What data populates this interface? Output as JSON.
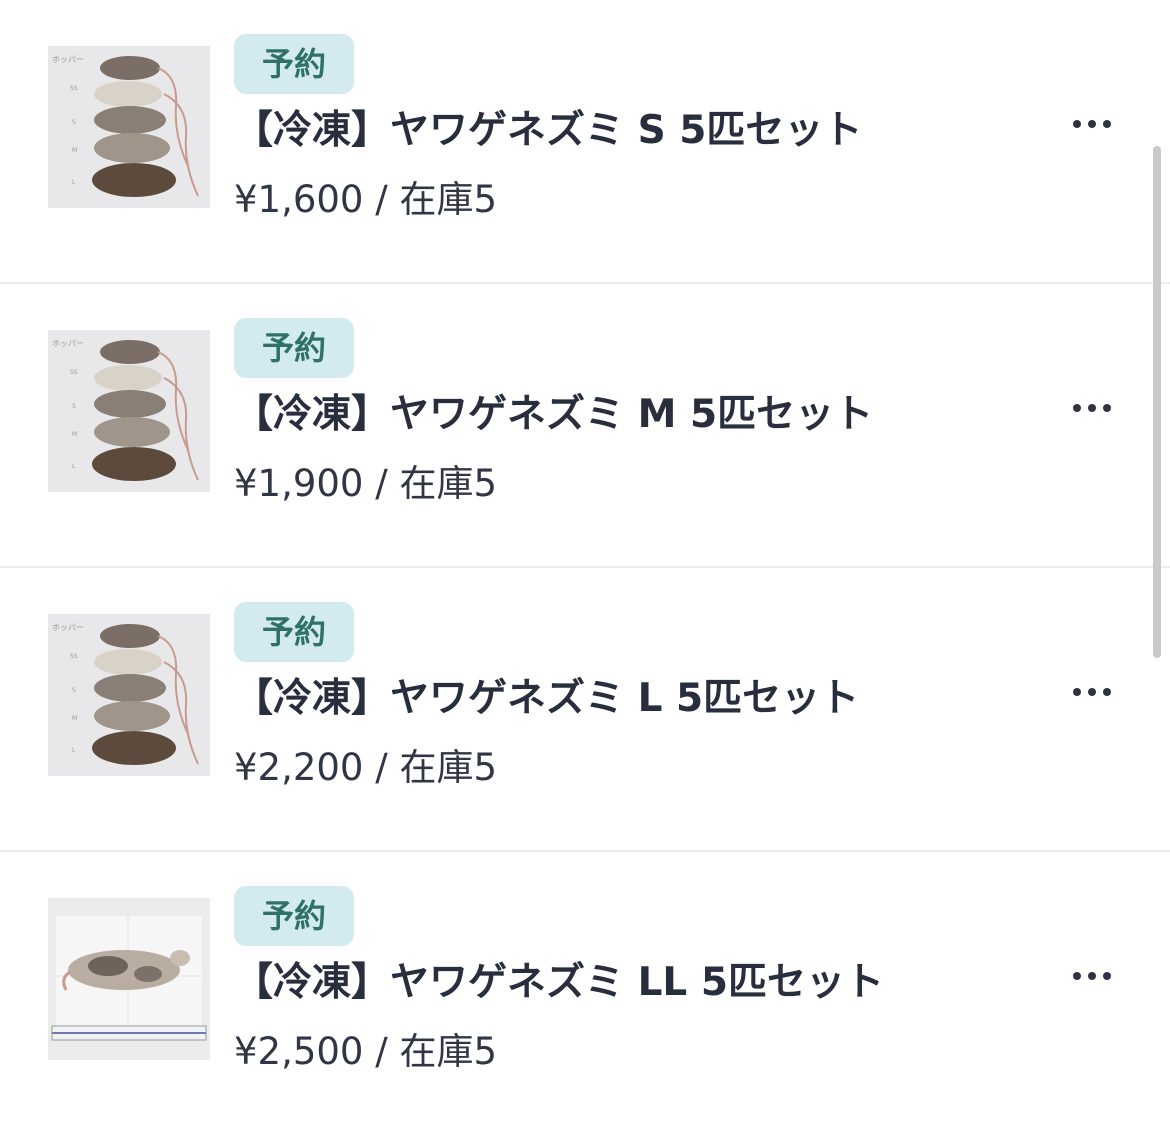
{
  "products": [
    {
      "badge": "予約",
      "title": "【冷凍】ヤワゲネズミ S 5匹セット",
      "price": "¥1,600",
      "separator": "/",
      "stock": "在庫5",
      "image": "mice-size-chart-photo",
      "image_labels": [
        "ホッパー",
        "SS",
        "S",
        "M",
        "L"
      ]
    },
    {
      "badge": "予約",
      "title": "【冷凍】ヤワゲネズミ M 5匹セット",
      "price": "¥1,900",
      "separator": "/",
      "stock": "在庫5",
      "image": "mice-size-chart-photo",
      "image_labels": [
        "ホッパー",
        "SS",
        "S",
        "M",
        "L"
      ]
    },
    {
      "badge": "予約",
      "title": "【冷凍】ヤワゲネズミ L 5匹セット",
      "price": "¥2,200",
      "separator": "/",
      "stock": "在庫5",
      "image": "mice-size-chart-photo",
      "image_labels": [
        "ホッパー",
        "SS",
        "S",
        "M",
        "L"
      ]
    },
    {
      "badge": "予約",
      "title": "【冷凍】ヤワゲネズミ LL 5匹セット",
      "price": "¥2,500",
      "separator": "/",
      "stock": "在庫5",
      "image": "single-mouse-with-ruler-photo",
      "image_labels": []
    }
  ],
  "more_icon": "ellipsis-horizontal-icon",
  "colors": {
    "badge_bg": "#d3ebee",
    "badge_text": "#2f7169",
    "title_text": "#282e3d",
    "divider": "#ececec",
    "scrollbar": "#c9c9cd"
  }
}
